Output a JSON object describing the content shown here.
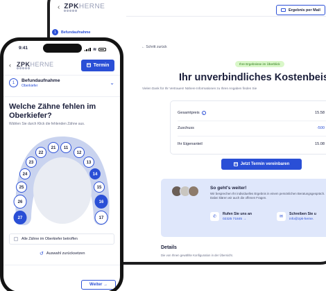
{
  "desktop": {
    "logo": {
      "bold": "ZPK",
      "light": "HERNE"
    },
    "mail_button": "Ergebnis per Mail",
    "back_link": "← Schritt zurück",
    "badge": "Ihre Ergebnisse im Überblick",
    "title": "Ihr unverbindliches Kostenbeispi",
    "subtitle": "Vielen Dank für Ihr Vertrauen! Nähere Informationen zu Ihren Angaben finden Sie",
    "price_rows": [
      {
        "label": "Gesamtpreis",
        "value": "15.58",
        "info": "i"
      },
      {
        "label": "Zuschuss",
        "value": "-500"
      },
      {
        "label": "Ihr Eigenanteil",
        "value": "15.08"
      }
    ],
    "termin_button": "Jetzt Termin vereinbaren",
    "next": {
      "title": "So geht's weiter!",
      "text": "Wir besprechen Ihr individuelles Ergebnis in einem persönlichen Beratungsgespräch. Dabei klären wir auch die offenen Fragen.",
      "call_title": "Rufen Sie uns an",
      "call_value": "02325 71845 →",
      "write_title": "Schreiben Sie u",
      "write_value": "info@zpk-herne."
    },
    "details_title": "Details",
    "details_sub": "Die von Ihnen gewählte Konfiguration in der Übersicht."
  },
  "peek": {
    "step_label": "Befundaufnahme",
    "step_num": "1"
  },
  "phone": {
    "time": "9:41",
    "logo": {
      "bold": "ZPK",
      "light": "HERNE"
    },
    "termin_button": "Termin",
    "step": {
      "num": "1",
      "title": "Befundaufnahme",
      "sub": "Oberkiefer"
    },
    "question": "Welche Zähne fehlen im Oberkiefer?",
    "question_sub": "Wählen Sie durch Klick die fehlenden Zähne aus.",
    "teeth": [
      {
        "n": "11",
        "selected": false
      },
      {
        "n": "12",
        "selected": false
      },
      {
        "n": "13",
        "selected": false
      },
      {
        "n": "14",
        "selected": true
      },
      {
        "n": "15",
        "selected": false
      },
      {
        "n": "16",
        "selected": true
      },
      {
        "n": "17",
        "selected": false
      },
      {
        "n": "21",
        "selected": false
      },
      {
        "n": "22",
        "selected": false
      },
      {
        "n": "23",
        "selected": false
      },
      {
        "n": "24",
        "selected": false
      },
      {
        "n": "25",
        "selected": false
      },
      {
        "n": "26",
        "selected": false
      },
      {
        "n": "27",
        "selected": true
      }
    ],
    "all_teeth_label": "Alle Zähne im Oberkiefer betroffen",
    "reset_label": "Auswahl zurücksetzen",
    "next_button": "Weiter →"
  },
  "colors": {
    "accent": "#2a4fd6",
    "badge_bg": "#d9f7c8",
    "card_bg": "#dfe7fb"
  }
}
